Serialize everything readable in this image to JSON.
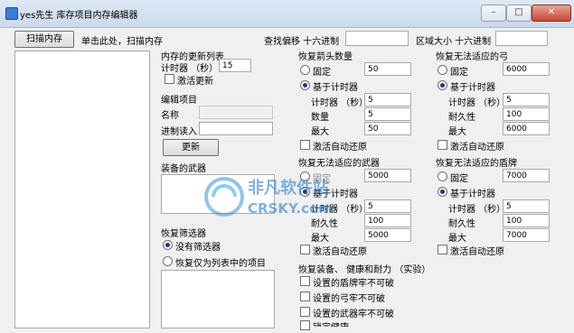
{
  "window": {
    "title": "yes先生 库存项目内存编辑器"
  },
  "toolbar": {
    "scan_button": "扫描内存",
    "scan_hint": "单击此处，扫描内存",
    "search_offset_label": "查找偏移 十六进制",
    "search_offset_value": "",
    "region_size_label": "区域大小 十六进制",
    "region_size_value": ""
  },
  "update_list": {
    "title": "内存的更新列表",
    "timer_label": "计时器 （秒）",
    "timer_value": "15",
    "activate_label": "激活更新"
  },
  "edit_item": {
    "title": "编辑项目",
    "name_label": "名称",
    "name_value": "",
    "hex_read_label": "进制读入",
    "hex_read_value": "",
    "update_button": "更新"
  },
  "equipped": {
    "title": "装备的武器"
  },
  "filter": {
    "title": "恢复筛选器",
    "option1": "没有筛选器",
    "option2": "恢复仅为列表中的项目"
  },
  "arrows": {
    "title": "恢复箭头数量",
    "fixed_label": "固定",
    "fixed_value": "50",
    "timer_based_label": "基于计时器",
    "timer_label": "计时器 （秒）",
    "timer_value": "5",
    "qty_label": "数量",
    "qty_value": "5",
    "max_label": "最大",
    "max_value": "50",
    "auto_label": "激活自动还原"
  },
  "bow": {
    "title": "恢复无法适应的弓",
    "fixed_label": "固定",
    "fixed_value": "6000",
    "timer_based_label": "基于计时器",
    "timer_label": "计时器 （秒）",
    "timer_value": "5",
    "durability_label": "耐久性",
    "durability_value": "100",
    "max_label": "最大",
    "max_value": "6000",
    "auto_label": "激活自动还原"
  },
  "weapon": {
    "title": "恢复无法适应的武器",
    "fixed_label": "固定",
    "fixed_value": "5000",
    "timer_based_label": "基于计时器",
    "timer_label": "计时器 （秒）",
    "timer_value": "5",
    "durability_label": "耐久性",
    "durability_value": "100",
    "max_label": "最大",
    "max_value": "5000",
    "auto_label": "激活自动还原"
  },
  "shield": {
    "title": "恢复无法适应的盾牌",
    "fixed_label": "固定",
    "fixed_value": "7000",
    "timer_based_label": "基于计时器",
    "timer_label": "计时器 （秒）",
    "timer_value": "5",
    "durability_label": "耐久性",
    "durability_value": "100",
    "max_label": "最大",
    "max_value": "7000",
    "auto_label": "激活自动还原"
  },
  "restore": {
    "title": "恢复装备、 健康和耐力 （实验）",
    "opt1": "设置的盾牌牢不可破",
    "opt2": "设置的弓牢不可破",
    "opt3": "设置的武器牢不可破",
    "opt4": "锁定健康"
  },
  "watermark": {
    "line1": "非凡软件站",
    "line2": "CRSKY.com"
  }
}
